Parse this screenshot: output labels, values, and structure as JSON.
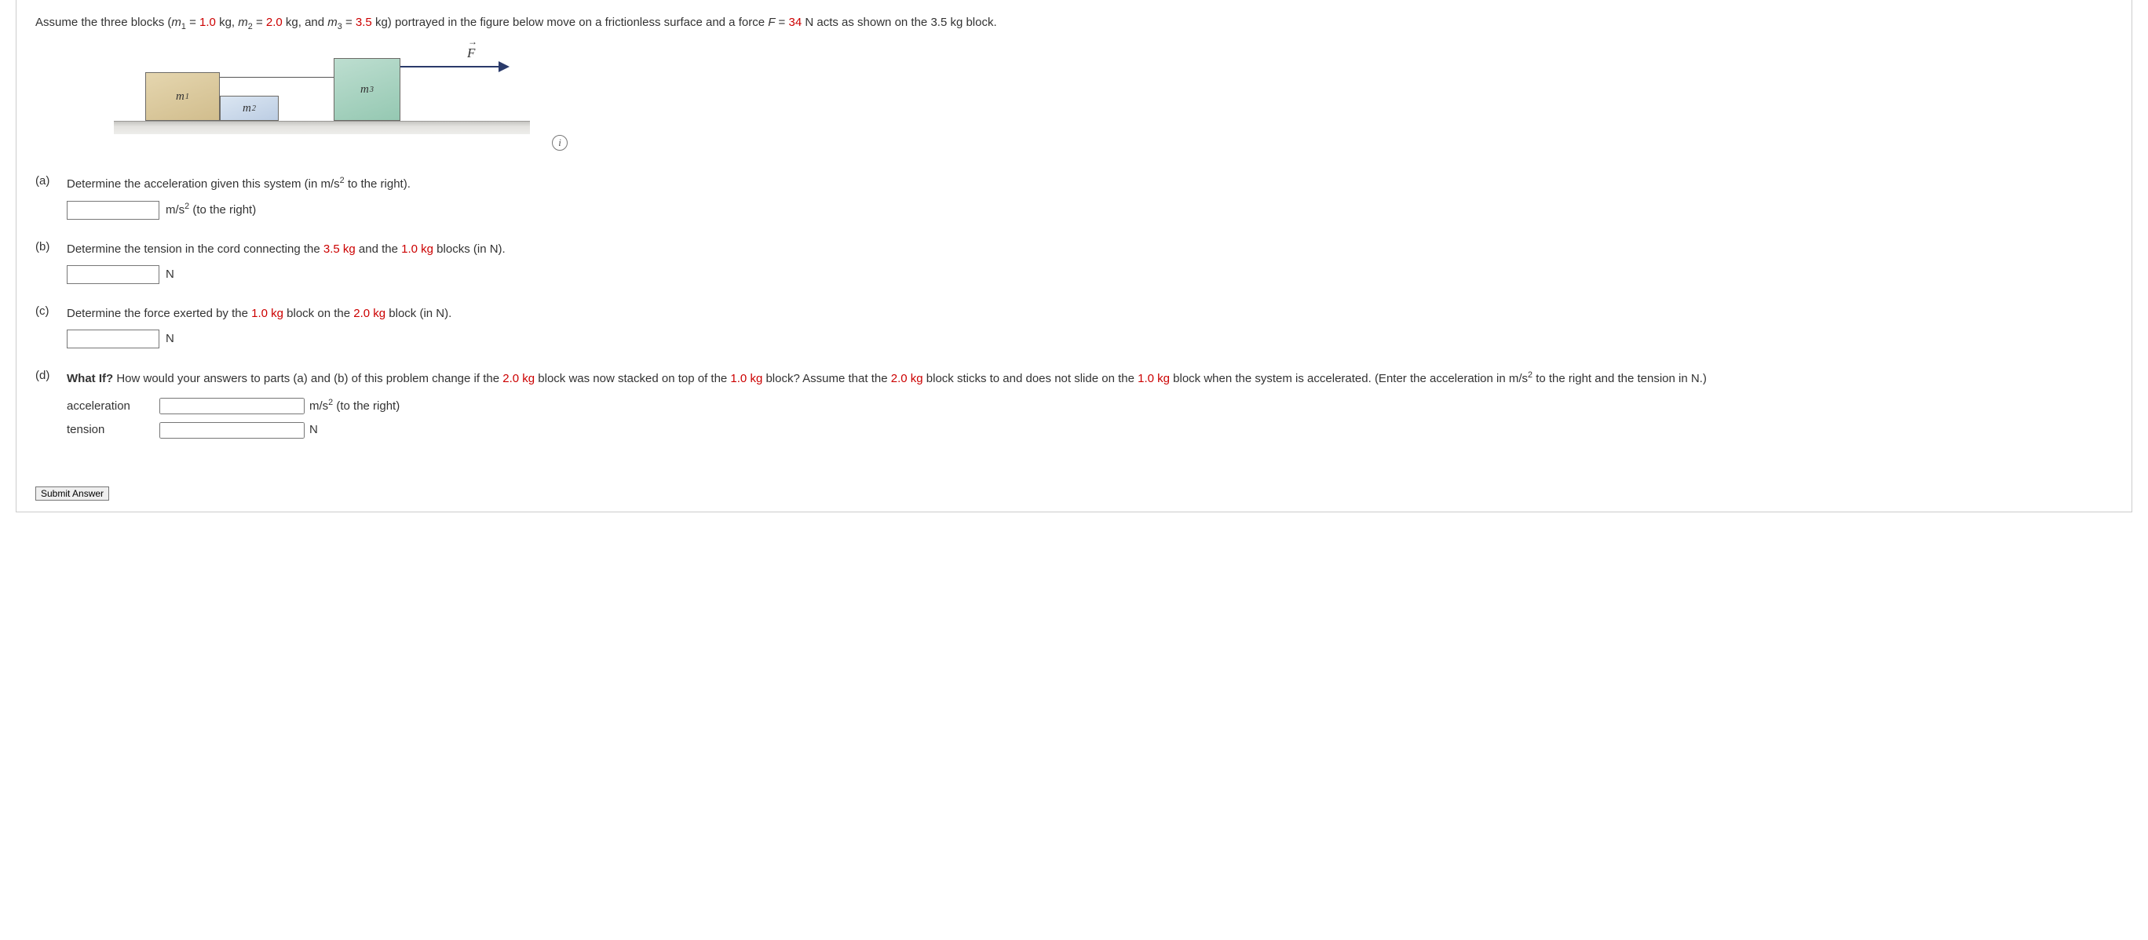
{
  "statement": {
    "prefix": "Assume the three blocks (",
    "m1_var": "m",
    "m1_sub": "1",
    "eq": " = ",
    "m1_val": "1.0",
    "kg_sep": " kg, ",
    "m2_var": "m",
    "m2_sub": "2",
    "m2_val": "2.0",
    "kg_and": " kg, and ",
    "m3_var": "m",
    "m3_sub": "3",
    "m3_val": "3.5",
    "mid": " kg) portrayed in the figure below move on a frictionless surface and a force ",
    "F_var": "F",
    "F_eq": " = ",
    "F_val": "34",
    "suffix": " N acts as shown on the 3.5 kg block."
  },
  "figure": {
    "m1_label": "m",
    "m1_sub": "1",
    "m2_label": "m",
    "m2_sub": "2",
    "m3_label": "m",
    "m3_sub": "3",
    "force_label": "F",
    "info_glyph": "i"
  },
  "parts": {
    "a": {
      "label": "(a)",
      "text_pre": "Determine the acceleration given this system (in m/s",
      "text_sup": "2",
      "text_post": " to the right).",
      "unit_pre": "m/s",
      "unit_sup": "2",
      "unit_post": " (to the right)"
    },
    "b": {
      "label": "(b)",
      "text_pre": "Determine the tension in the cord connecting the ",
      "val1": "3.5 kg",
      "mid": " and the ",
      "val2": "1.0 kg",
      "text_post": " blocks (in N).",
      "unit": "N"
    },
    "c": {
      "label": "(c)",
      "text_pre": "Determine the force exerted by the ",
      "val1": "1.0 kg",
      "mid": " block on the ",
      "val2": "2.0 kg",
      "text_post": " block (in N).",
      "unit": "N"
    },
    "d": {
      "label": "(d)",
      "whatif": "What If?",
      "text1_pre": " How would your answers to parts (a) and (b) of this problem change if the ",
      "v1": "2.0 kg",
      "text1_mid1": " block was now stacked on top of the ",
      "v2": "1.0 kg",
      "text1_mid2": " block? Assume that the ",
      "v3": "2.0 kg",
      "text1_mid3": " block sticks to and does not slide on the ",
      "v4": "1.0 kg",
      "text1_post_pre": " block when the system is accelerated. (Enter the acceleration in m/s",
      "text1_sup": "2",
      "text1_post_post": " to the right and the tension in N.)",
      "accel_label": "acceleration",
      "accel_unit_pre": "m/s",
      "accel_unit_sup": "2",
      "accel_unit_post": " (to the right)",
      "tension_label": "tension",
      "tension_unit": "N"
    }
  },
  "submit_label": "Submit Answer"
}
